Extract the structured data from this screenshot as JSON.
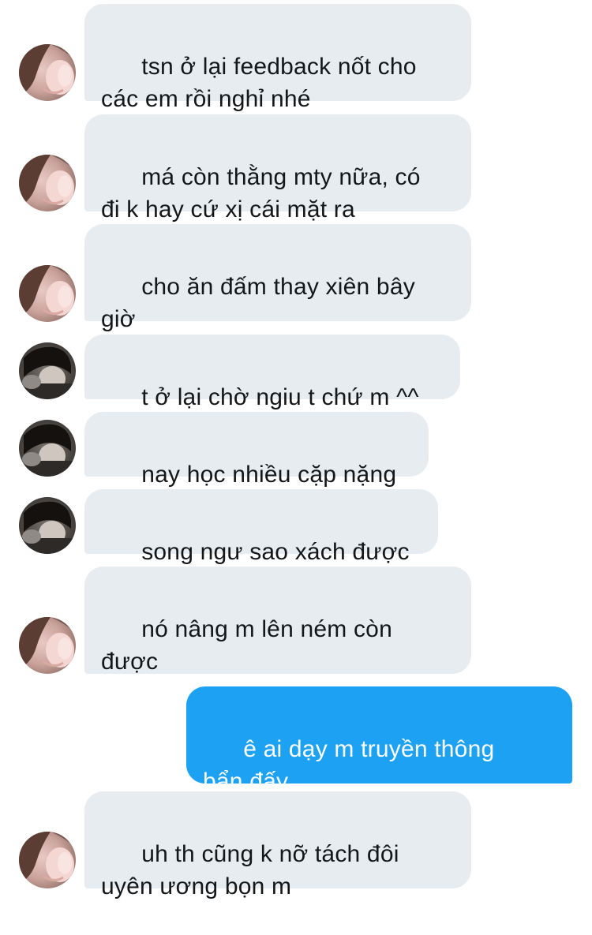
{
  "thread": {
    "messages": [
      {
        "from": "them",
        "avatar": "avatar-girl",
        "text": "tsn ở lại feedback nốt cho\ncác em rồi nghỉ nhé"
      },
      {
        "from": "them",
        "avatar": "avatar-girl",
        "text": "má còn thằng mty nữa, có\nđi k hay cứ xị cái mặt ra"
      },
      {
        "from": "them",
        "avatar": "avatar-girl",
        "text": "cho ăn đấm thay xiên bây\ngiờ"
      },
      {
        "from": "them",
        "avatar": "avatar-boy",
        "text": "t ở lại chờ ngiu t chứ m ^^"
      },
      {
        "from": "them",
        "avatar": "avatar-boy",
        "text": "nay học nhiều cặp nặng"
      },
      {
        "from": "them",
        "avatar": "avatar-boy",
        "text": "song ngư sao xách được"
      },
      {
        "from": "them",
        "avatar": "avatar-girl",
        "text": "nó nâng m lên ném còn\nđược",
        "emoji": "smiling-face-with-hearts-icon"
      },
      {
        "from": "me",
        "text": "ê ai dạy m truyền thông\nbẩn đấy"
      },
      {
        "from": "them",
        "avatar": "avatar-girl",
        "text": "uh th cũng k nỡ tách đôi\nuyên ương bọn m"
      }
    ]
  },
  "colors": {
    "incoming_bubble": "#e6ecf0",
    "outgoing_bubble": "#1da1f2",
    "incoming_text": "#14171a",
    "outgoing_text": "#ffffff"
  }
}
